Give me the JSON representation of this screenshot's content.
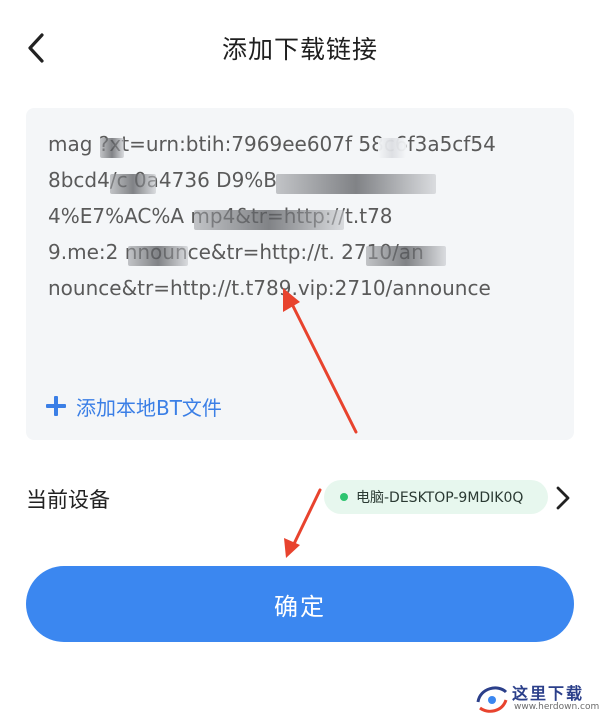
{
  "header": {
    "title": "添加下载链接",
    "back_icon": "chevron-left-icon"
  },
  "link_input": {
    "value": "mag ■ ?xt=urn:btih:7969ee607f■ 58c6f3a5cf548bcd4/c■ 70a4736 ■ ■ ■ ■ D9%B4%E7%AC%A ■ ■ mp4&tr=http://t.t789.me:2■ ■nnounce&tr=http://t.■ 2710/announce&tr=http://t.t789.vip:2710/announce",
    "lines": [
      "mag   ?xt=urn:btih:7969ee607f   58c6f3a5cf54",
      "8bcd4/c     0a4736                    D9%B",
      "4%E7%AC%A                       mp4&tr=http://t.t78",
      "9.me:2        nnounce&tr=http://t.              2710/an",
      "nounce&tr=http://t.t789.vip:2710/announce"
    ]
  },
  "add_local_bt": {
    "label": "添加本地BT文件",
    "icon": "plus-icon"
  },
  "device": {
    "label": "当前设备",
    "chip_text": "电脑-DESKTOP-9MDIK0Q",
    "status_color": "#2ec46f",
    "chevron_icon": "chevron-right-icon"
  },
  "confirm": {
    "label": "确定"
  },
  "watermark": {
    "brand": "这里下载",
    "url": "www.herdown.com"
  },
  "colors": {
    "accent": "#3b87f0",
    "link_blue": "#3b7fe6",
    "annotation_red": "#e8432e"
  }
}
